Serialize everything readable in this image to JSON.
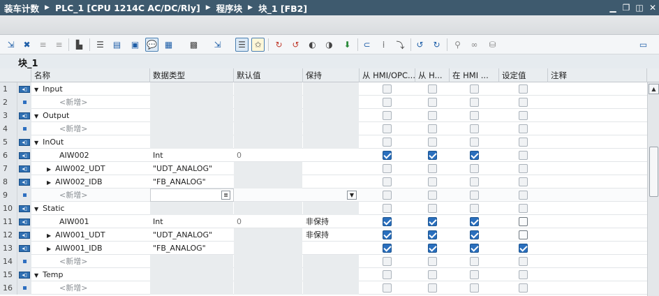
{
  "breadcrumb": [
    "装车计数",
    "PLC_1 [CPU 1214C AC/DC/Rly]",
    "程序块",
    "块_1 [FB2]"
  ],
  "window_buttons": [
    "minimize-icon",
    "restore-icon",
    "float-icon",
    "close-icon"
  ],
  "block_name": "块_1",
  "columns": [
    "名称",
    "数据类型",
    "默认值",
    "保持",
    "从 HMI/OPC...",
    "从 H...",
    "在 HMI ...",
    "设定值",
    "注释"
  ],
  "rows": [
    {
      "num": "1",
      "kind": "section",
      "name": "Input"
    },
    {
      "num": "2",
      "kind": "add",
      "name": "<新增>"
    },
    {
      "num": "3",
      "kind": "section",
      "name": "Output"
    },
    {
      "num": "4",
      "kind": "add",
      "name": "<新增>"
    },
    {
      "num": "5",
      "kind": "section",
      "name": "InOut"
    },
    {
      "num": "6",
      "kind": "var",
      "name": "AIW002",
      "type": "Int",
      "default": "0",
      "retain": "",
      "hmi_acc": true,
      "hmi_vis": true,
      "hmi_set": true,
      "setpoint": false
    },
    {
      "num": "7",
      "kind": "struct",
      "name": "AIW002_UDT",
      "type": "\"UDT_ANALOG\"",
      "default": "",
      "retain": ""
    },
    {
      "num": "8",
      "kind": "struct",
      "name": "AIW002_IDB",
      "type": "\"FB_ANALOG\"",
      "default": "",
      "retain": ""
    },
    {
      "num": "9",
      "kind": "editing",
      "name": "<新增>"
    },
    {
      "num": "10",
      "kind": "section",
      "name": "Static"
    },
    {
      "num": "11",
      "kind": "var",
      "name": "AIW001",
      "type": "Int",
      "default": "0",
      "retain": "非保持",
      "hmi_acc": true,
      "hmi_vis": true,
      "hmi_set": true,
      "setpoint": false
    },
    {
      "num": "12",
      "kind": "var",
      "name": "AIW001_UDT",
      "type": "\"UDT_ANALOG\"",
      "default": "",
      "retain": "非保持",
      "expandable": true,
      "hmi_acc": true,
      "hmi_vis": true,
      "hmi_set": true,
      "setpoint": false
    },
    {
      "num": "13",
      "kind": "var",
      "name": "AIW001_IDB",
      "type": "\"FB_ANALOG\"",
      "default": "",
      "retain": "",
      "expandable": true,
      "hmi_acc": true,
      "hmi_vis": true,
      "hmi_set": true,
      "setpoint": true
    },
    {
      "num": "14",
      "kind": "add",
      "name": "<新增>"
    },
    {
      "num": "15",
      "kind": "section",
      "name": "Temp"
    },
    {
      "num": "16",
      "kind": "add",
      "name": "<新增>"
    }
  ]
}
